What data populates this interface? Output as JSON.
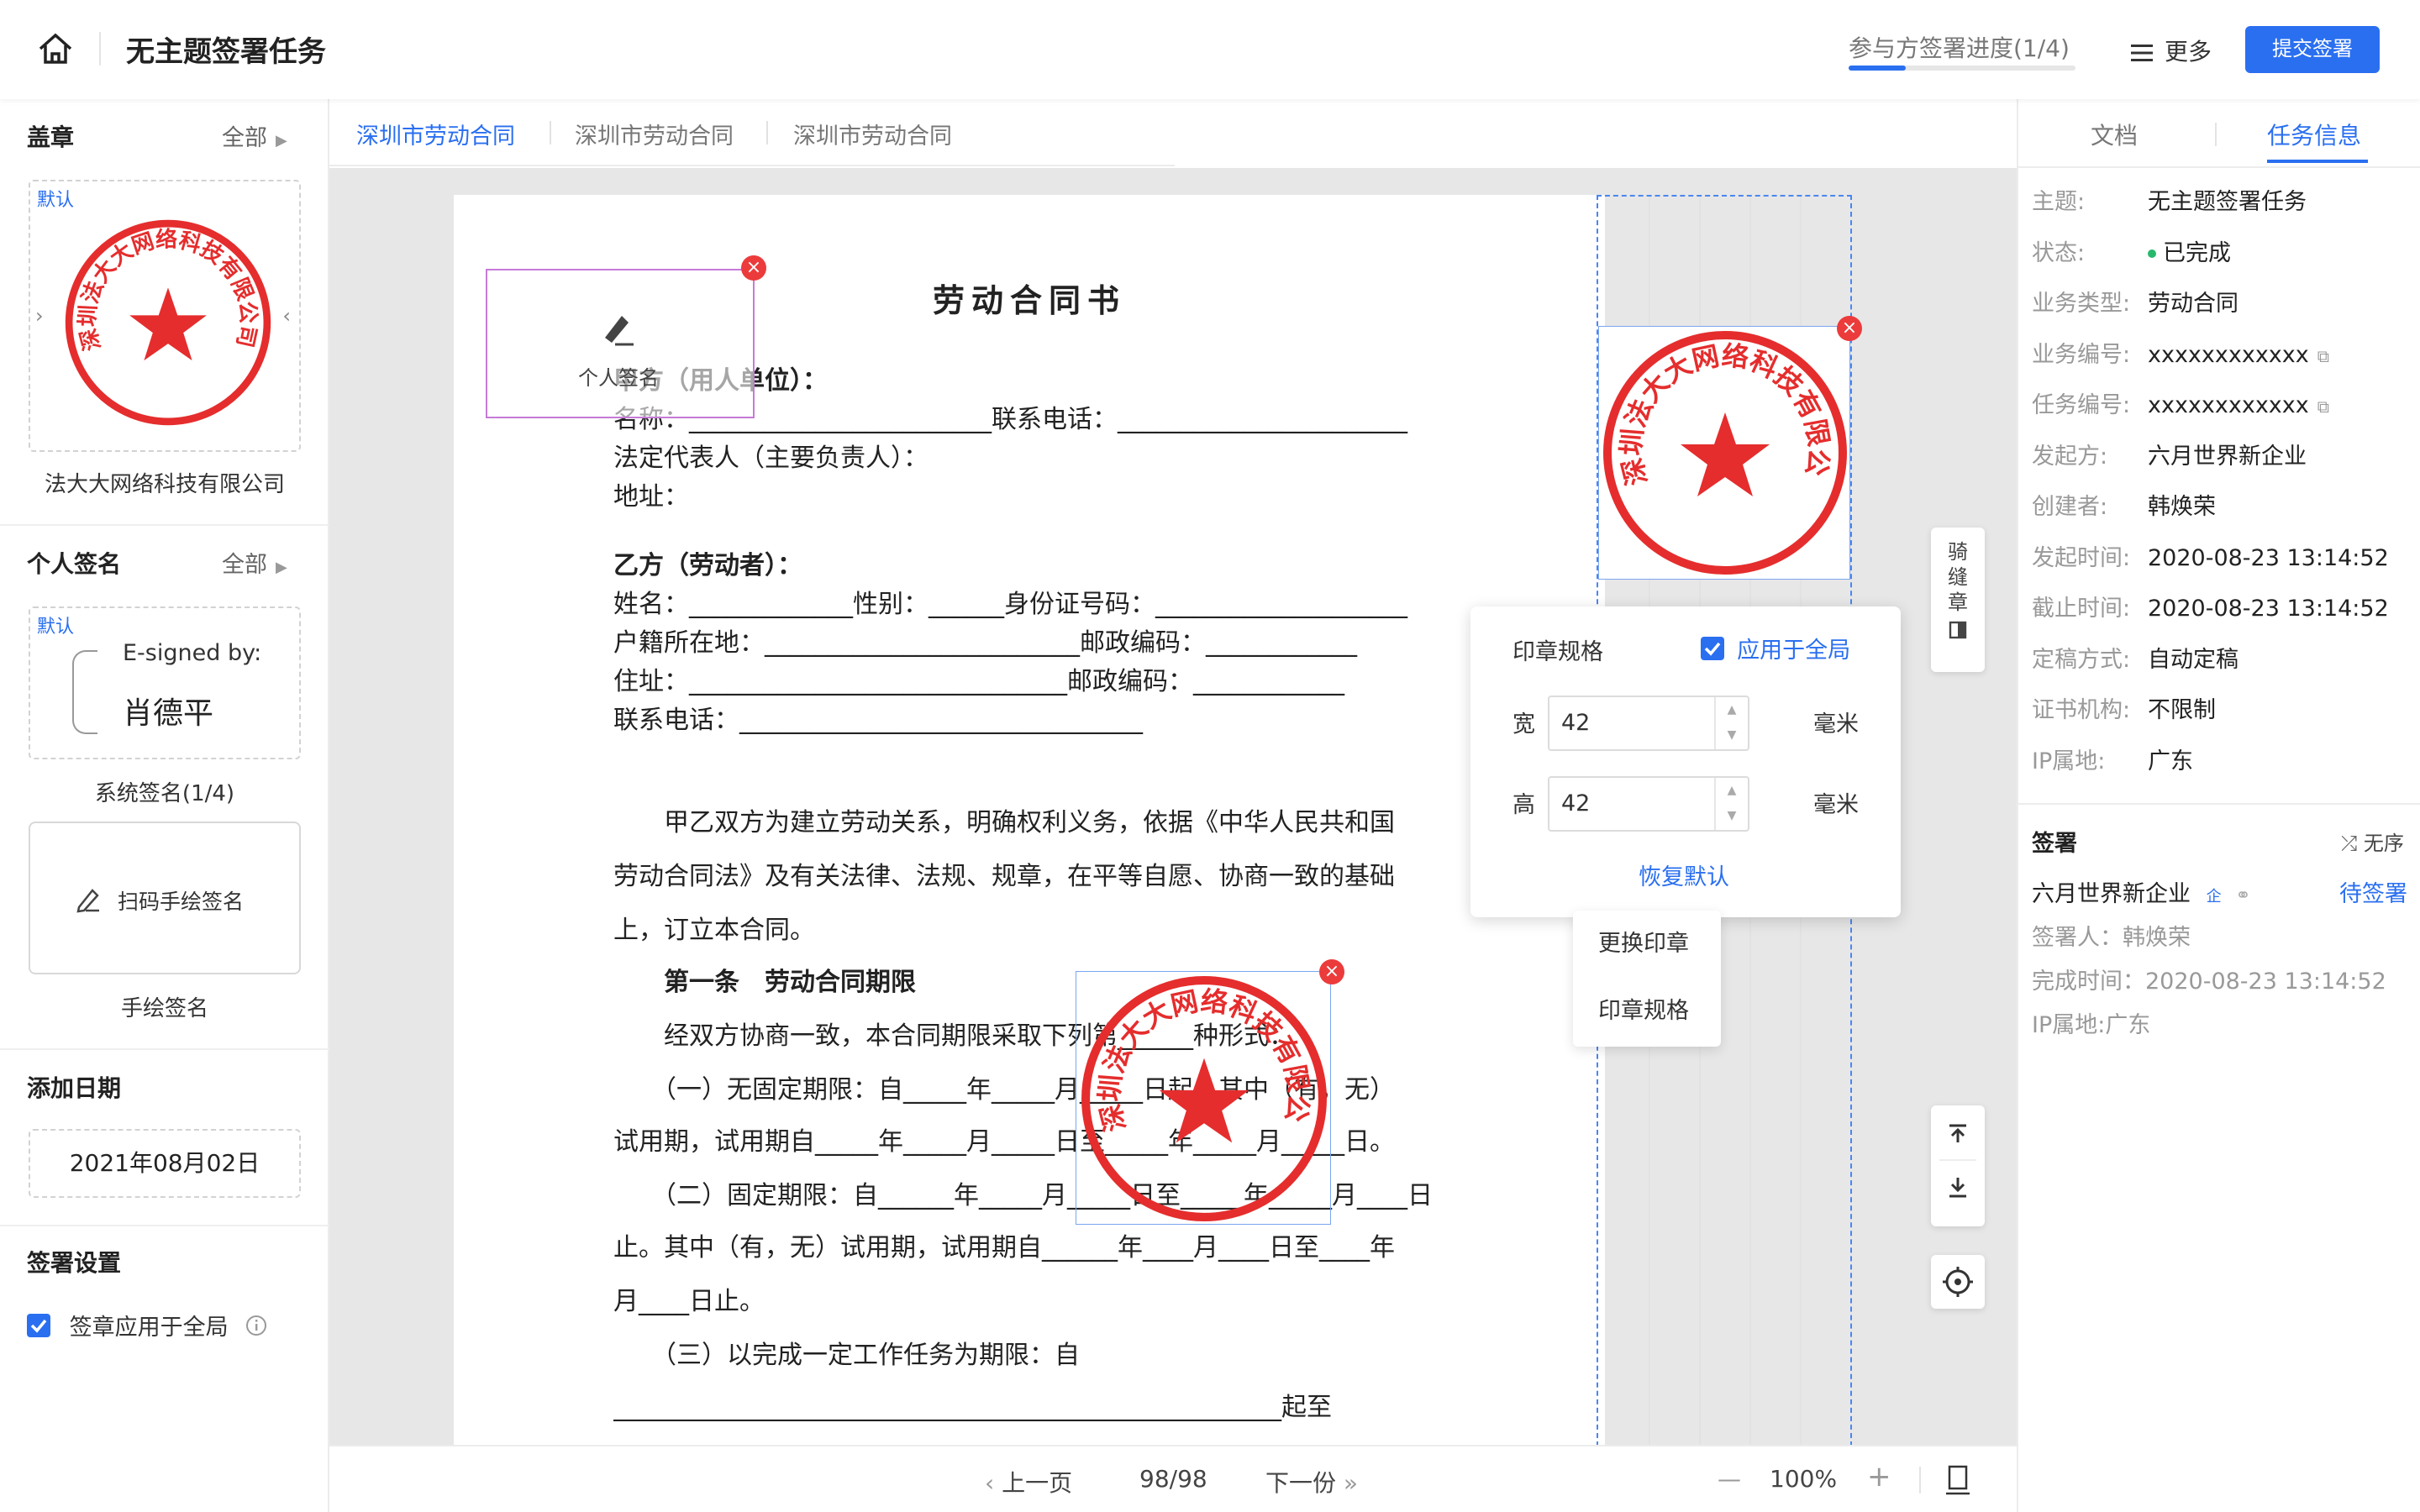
{
  "header": {
    "title": "无主题签署任务",
    "progress_label": "参与方签署进度(1/4)",
    "progress_fraction": 0.25,
    "more_label": "更多",
    "submit_label": "提交签署"
  },
  "left": {
    "seal_section": {
      "title": "盖章",
      "all_label": "全部"
    },
    "company_seal": {
      "badge": "默认",
      "ring_text": "深圳法大大网络科技有限公司",
      "label": "法大大网络科技有限公司"
    },
    "personal_section": {
      "title": "个人签名",
      "all_label": "全部"
    },
    "system_signature": {
      "badge": "默认",
      "esigned": "E-signed by:",
      "name": "肖德平",
      "label": "系统签名(1/4)"
    },
    "hand_signature": {
      "button_label": "扫码手绘签名",
      "label": "手绘签名"
    },
    "date_section": {
      "title": "添加日期",
      "value": "2021年08月02日"
    },
    "settings_section": {
      "title": "签署设置",
      "apply_all_label": "签章应用于全局",
      "apply_all_checked": true
    }
  },
  "doc_tabs": [
    "深圳市劳动合同",
    "深圳市劳动合同",
    "深圳市劳动合同"
  ],
  "document": {
    "title": "劳动合同书",
    "personal_sig_placeholder": "个人签名",
    "lines": {
      "partyA": "甲方（用人单位）：",
      "nameA": "名称：________________________联系电话：_______________________",
      "legal": "法定代表人（主要负责人）：",
      "addr": "地址：",
      "partyB": "乙方（劳动者）：",
      "nameB": "姓名：_____________性别：______身份证号码：____________________",
      "huji": "户籍所在地：_________________________邮政编码：____________",
      "zhuzhi": "住址：______________________________邮政编码：____________",
      "phone": "联系电话：________________________________",
      "p1": "　　甲乙双方为建立劳动关系，明确权利义务，依据《中华人民共和国",
      "p2": "劳动合同法》及有关法律、法规、规章，在平等自愿、协商一致的基础",
      "p3": "上，订立本合同。",
      "art1": "　　第一条　劳动合同期限",
      "a1": "　　经双方协商一致，本合同期限采取下列第______种形式：",
      "a2": "　　（一）无固定期限：自_____年_____月_____日起。其中（有，无）",
      "a3": "试用期，试用期自_____年_____月_____日至_____年_____月_____日。",
      "a4": "　　（二）固定期限：自______年_____月_____日至_____年_____月____日",
      "a5": "止。其中（有，无）试用期，试用期自______年____月____日至____年",
      "a6": "月____日止。",
      "a7": "　　（三）以完成一定工作任务为期限：自",
      "a8": "_____________________________________________________起至"
    }
  },
  "seal_popup": {
    "title": "印章规格",
    "apply_label": "应用于全局",
    "apply_checked": true,
    "width_label": "宽",
    "width_value": "42",
    "height_label": "高",
    "height_value": "42",
    "unit": "毫米",
    "reset_label": "恢复默认"
  },
  "context_menu": [
    "更换印章",
    "印章规格"
  ],
  "riding_seal": {
    "chars": [
      "骑",
      "缝",
      "章"
    ]
  },
  "footer": {
    "prev": "上一页",
    "page": "98/98",
    "next": "下一份",
    "zoom": "100%"
  },
  "right": {
    "tabs": [
      "文档",
      "任务信息"
    ],
    "info": [
      {
        "k": "主题:",
        "v": "无主题签署任务"
      },
      {
        "k": "状态:",
        "v": "已完成"
      },
      {
        "k": "业务类型:",
        "v": "劳动合同"
      },
      {
        "k": "业务编号:",
        "v": "xxxxxxxxxxxx"
      },
      {
        "k": "任务编号:",
        "v": "xxxxxxxxxxxx"
      },
      {
        "k": "发起方:",
        "v": "六月世界新企业"
      },
      {
        "k": "创建者:",
        "v": "韩焕荣"
      },
      {
        "k": "发起时间:",
        "v": "2020-08-23 13:14:52"
      },
      {
        "k": "截止时间:",
        "v": "2020-08-23 13:14:52"
      },
      {
        "k": "定稿方式:",
        "v": "自动定稿"
      },
      {
        "k": "证书机构:",
        "v": "不限制"
      },
      {
        "k": "IP属地:",
        "v": "广东"
      }
    ],
    "signing": {
      "title": "签署",
      "order_label": "无序",
      "party": "六月世界新企业",
      "party_badge": "企",
      "status": "待签署",
      "signer": "签署人：韩焕荣",
      "finished": "完成时间：2020-08-23 13:14:52",
      "ip": "IP属地:广东"
    }
  },
  "colors": {
    "accent": "#2a6ff0",
    "seal_red": "#e52d2d",
    "done_green": "#27b86c"
  }
}
